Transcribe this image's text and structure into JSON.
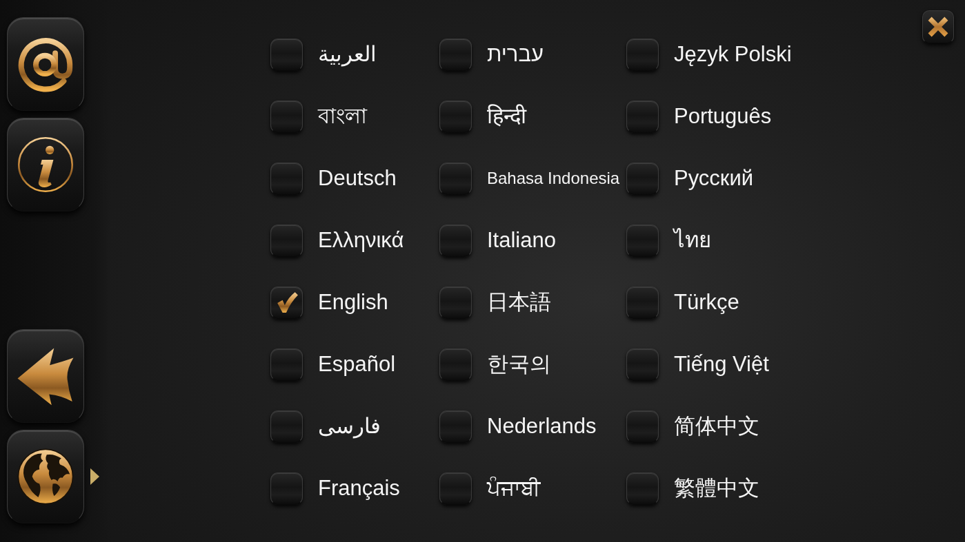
{
  "sidebar": {
    "top": [
      {
        "kind": "email",
        "selected": false
      },
      {
        "kind": "info",
        "selected": false
      }
    ],
    "bottom": [
      {
        "kind": "back",
        "selected": false
      },
      {
        "kind": "language",
        "selected": true
      }
    ]
  },
  "languages": [
    {
      "label": "العربية",
      "checked": false
    },
    {
      "label": "বাংলা",
      "checked": false
    },
    {
      "label": "Deutsch",
      "checked": false
    },
    {
      "label": "Ελληνικά",
      "checked": false
    },
    {
      "label": "English",
      "checked": true
    },
    {
      "label": "Español",
      "checked": false
    },
    {
      "label": "فارسی",
      "checked": false
    },
    {
      "label": "Français",
      "checked": false
    },
    {
      "label": "עברית",
      "checked": false
    },
    {
      "label": "हिन्दी",
      "checked": false
    },
    {
      "label": "Bahasa Indonesia",
      "checked": false
    },
    {
      "label": "Italiano",
      "checked": false
    },
    {
      "label": "日本語",
      "checked": false
    },
    {
      "label": "한국의",
      "checked": false
    },
    {
      "label": "Nederlands",
      "checked": false
    },
    {
      "label": "ਪੰਜਾਬੀ",
      "checked": false
    },
    {
      "label": "Język Polski",
      "checked": false
    },
    {
      "label": "Português",
      "checked": false
    },
    {
      "label": "Русский",
      "checked": false
    },
    {
      "label": "ไทย",
      "checked": false
    },
    {
      "label": "Türkçe",
      "checked": false
    },
    {
      "label": "Tiếng Việt",
      "checked": false
    },
    {
      "label": "简体中文",
      "checked": false
    },
    {
      "label": "繁體中文",
      "checked": false
    }
  ]
}
